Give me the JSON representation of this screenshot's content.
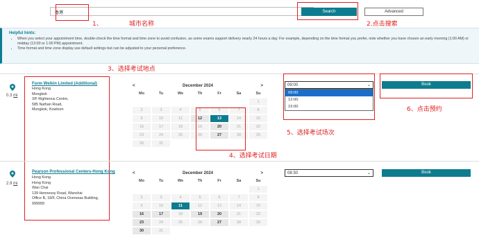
{
  "search": {
    "value": "香港",
    "button_label": "Search",
    "advanced_label": "Advanced"
  },
  "annotations": {
    "a1": "1、",
    "city_name": "城市名称",
    "click_search": "2.点击搜索",
    "select_location": "3、选择考试地点",
    "select_date": "4、选择考试日期",
    "select_session": "5、选择考试场次",
    "click_book": "6、点击预约"
  },
  "hints": {
    "title": "Helpful hints:",
    "items": [
      "When you select your appointment time, double-check the time format and time zone to avoid confusion, as some exams support delivery nearly 24 hours a day. For example, depending on the time format you prefer, note whether you have chosen an early morning (1:00 AM) or midday (13:00 or 1:00 PM) appointment.",
      "Time format and time zone display use default settings but can be adjusted to your personal preference."
    ]
  },
  "centers": [
    {
      "distance": "0.3",
      "unit": "mi",
      "name": "Form Welkin Limited (Additional)",
      "address": [
        "Hong Kong",
        "Mongkok",
        "3/F Righteous Centre,",
        "585 Nathan Road,",
        "Mongkok, Kowloon"
      ],
      "calendar": {
        "month": "December 2024",
        "prev": "<",
        "next": ">"
      },
      "time_selected": "09:00",
      "time_options": [
        "09:00",
        "12:00",
        "15:00"
      ],
      "book_label": "Book"
    },
    {
      "distance": "2.9",
      "unit": "mi",
      "name": "Pearson Professional Centers-Hong Kong",
      "address": [
        "Hong Kong",
        "Hong Kong",
        "Wan Chai",
        "139 Hennessy Road, Wanchai",
        "Office B, 18/F, China Overseas Building,",
        "999999"
      ],
      "calendar": {
        "month": "December 2024",
        "prev": "<",
        "next": ">"
      },
      "time_selected": "08:30",
      "book_label": "Book"
    }
  ],
  "weekdays": [
    "Mo",
    "Tu",
    "We",
    "Th",
    "Fr",
    "Sa",
    "Su"
  ],
  "calendar_weeks": [
    [
      "",
      "",
      "",
      "",
      "",
      "",
      "1"
    ],
    [
      "2",
      "3",
      "4",
      "5",
      "6",
      "7",
      "8"
    ],
    [
      "9",
      "10",
      "11",
      "12",
      "13",
      "14",
      "15"
    ],
    [
      "16",
      "17",
      "18",
      "19",
      "20",
      "21",
      "22"
    ],
    [
      "23",
      "24",
      "25",
      "26",
      "27",
      "28",
      "29"
    ],
    [
      "30",
      "31",
      "",
      "",
      "",
      "",
      ""
    ]
  ],
  "cal1_available": [
    "12",
    "13",
    "20",
    "27"
  ],
  "cal1_selected": "13",
  "cal2_available": [
    "16",
    "17",
    "19",
    "20",
    "23",
    "27",
    "30"
  ],
  "cal2_selected": "11",
  "colors": {
    "accent": "#0e7c8f",
    "annotation": "#e02020",
    "dropdown_highlight": "#1a6ec9"
  }
}
